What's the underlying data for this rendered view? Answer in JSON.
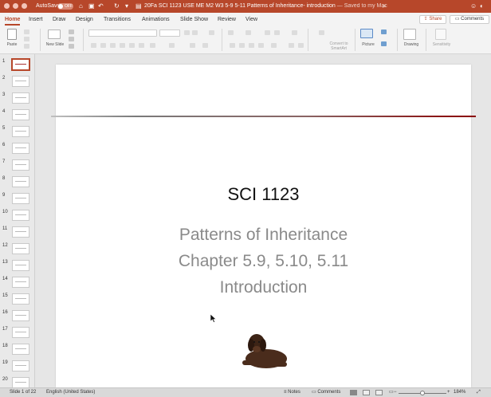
{
  "app": {
    "accent": "#b7472a",
    "autosave_label": "AutoSave",
    "autosave_state": "OFF",
    "document_title": "20Fa SCI 1123 USE ME M2 W3 5-9 5-11 Patterns of Inheritance- introduction",
    "save_status": "— Saved to my Mac"
  },
  "tabs": [
    "Home",
    "Insert",
    "Draw",
    "Design",
    "Transitions",
    "Animations",
    "Slide Show",
    "Review",
    "View"
  ],
  "active_tab": "Home",
  "share_label": "Share",
  "comments_label": "Comments",
  "ribbon": {
    "paste_label": "Paste",
    "new_slide_label": "New Slide",
    "convert_label": "Convert to SmartArt",
    "picture_label": "Picture",
    "drawing_label": "Drawing",
    "sensitivity_label": "Sensitivity"
  },
  "thumbnails": [
    "1",
    "2",
    "3",
    "4",
    "5",
    "6",
    "7",
    "8",
    "9",
    "10",
    "11",
    "12",
    "13",
    "14",
    "15",
    "16",
    "17",
    "18",
    "19",
    "20"
  ],
  "slide": {
    "title": "SCI 1123",
    "subtitle_lines": [
      "Patterns of Inheritance",
      "Chapter 5.9, 5.10, 5.11",
      "Introduction"
    ],
    "rule_color": "#8b0000"
  },
  "status": {
    "slide_position": "Slide 1 of 22",
    "language": "English (United States)",
    "notes_label": "Notes",
    "comments_label": "Comments",
    "zoom": "184%"
  }
}
